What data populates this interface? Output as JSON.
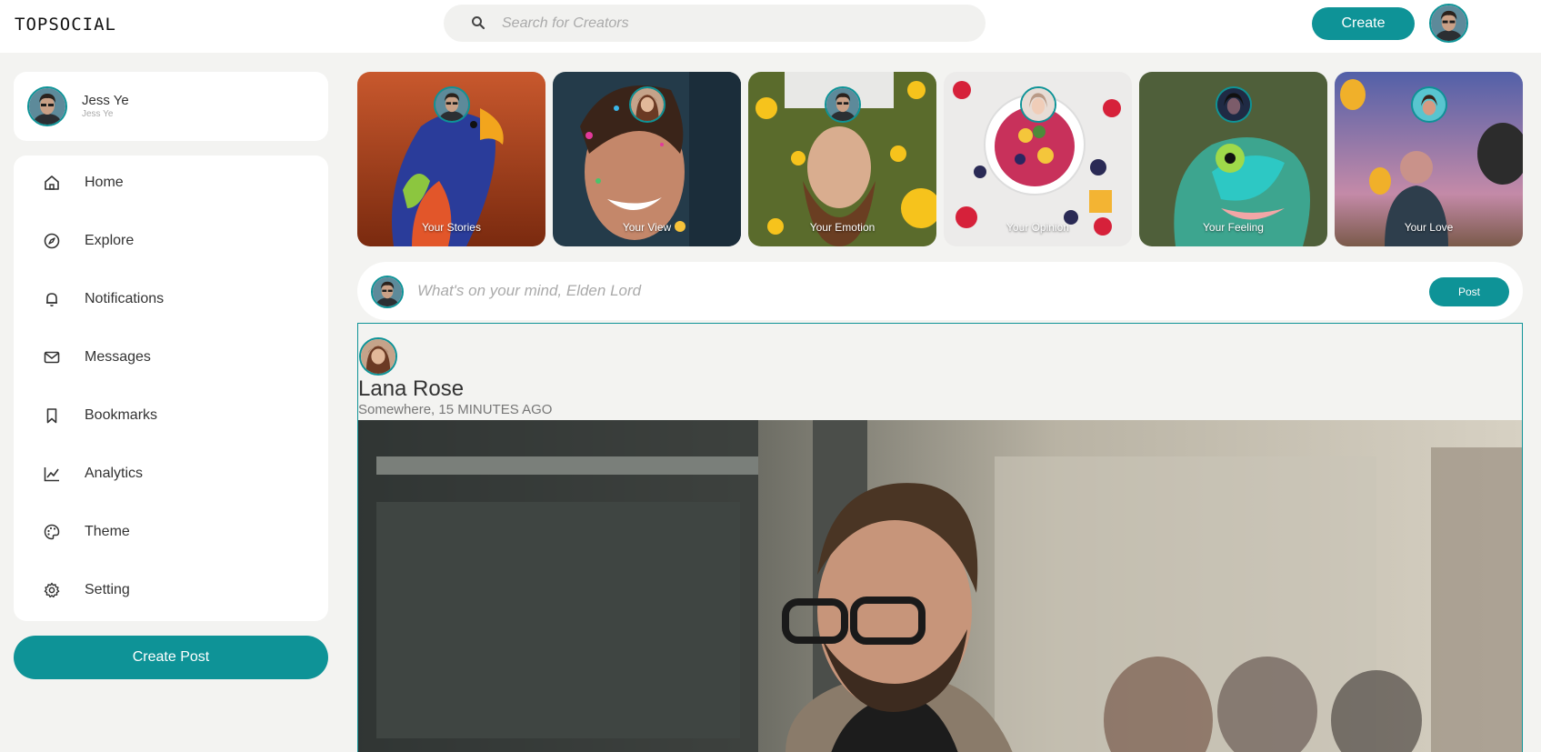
{
  "app": {
    "logo": "TOPSOCIAL",
    "accent": "#0e9397"
  },
  "search": {
    "placeholder": "Search for Creators",
    "icon": "search-icon"
  },
  "header": {
    "create_label": "Create"
  },
  "profile": {
    "name": "Jess Ye",
    "handle": "Jess Ye"
  },
  "sidebar": {
    "items": [
      {
        "label": "Home",
        "icon": "home-icon"
      },
      {
        "label": "Explore",
        "icon": "compass-icon"
      },
      {
        "label": "Notifications",
        "icon": "bell-icon"
      },
      {
        "label": "Messages",
        "icon": "mail-icon"
      },
      {
        "label": "Bookmarks",
        "icon": "bookmark-icon"
      },
      {
        "label": "Analytics",
        "icon": "chart-line-icon"
      },
      {
        "label": "Theme",
        "icon": "palette-icon"
      },
      {
        "label": "Setting",
        "icon": "gear-icon"
      }
    ],
    "create_post_label": "Create Post"
  },
  "stories": [
    {
      "label": "Your Stories"
    },
    {
      "label": "Your View"
    },
    {
      "label": "Your Emotion"
    },
    {
      "label": "Your Opinion"
    },
    {
      "label": "Your Feeling"
    },
    {
      "label": "Your Love"
    }
  ],
  "composer": {
    "placeholder": "What's on your mind, Elden Lord",
    "post_label": "Post"
  },
  "feed": {
    "post": {
      "author": "Lana Rose",
      "meta": "Somewhere, 15 MINUTES AGO"
    }
  }
}
